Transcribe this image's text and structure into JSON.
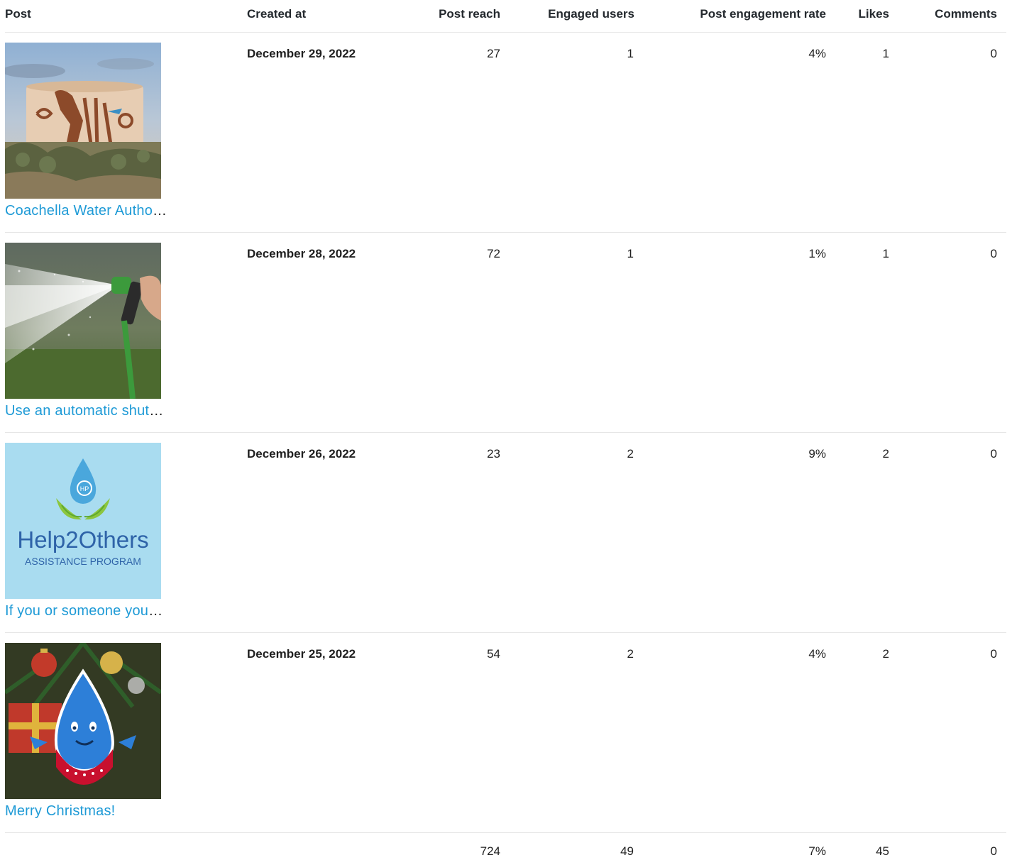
{
  "columns": {
    "post": "Post",
    "created_at": "Created at",
    "post_reach": "Post reach",
    "engaged_users": "Engaged users",
    "engagement_rate": "Post engagement rate",
    "likes": "Likes",
    "comments": "Comments"
  },
  "rows": [
    {
      "post_text": "Coachella Water Autho",
      "post_ellipsis": "…",
      "image": "water-tank-mural-image",
      "created_at": "December 29, 2022",
      "post_reach": "27",
      "engaged_users": "1",
      "engagement_rate": "4%",
      "likes": "1",
      "comments": "0"
    },
    {
      "post_text": "Use an automatic shut",
      "post_ellipsis": "…",
      "image": "garden-hose-spray-image",
      "created_at": "December 28, 2022",
      "post_reach": "72",
      "engaged_users": "1",
      "engagement_rate": "1%",
      "likes": "1",
      "comments": "0"
    },
    {
      "post_text": "If you or someone you",
      "post_ellipsis": "…",
      "image": "help2others-logo-image",
      "image_text_main": "Help2Others",
      "image_text_sub": "ASSISTANCE PROGRAM",
      "image_badge": "HP",
      "created_at": "December 26, 2022",
      "post_reach": "23",
      "engaged_users": "2",
      "engagement_rate": "9%",
      "likes": "2",
      "comments": "0"
    },
    {
      "post_text": "Merry Christmas!",
      "post_ellipsis": "",
      "image": "christmas-water-drop-image",
      "created_at": "December 25, 2022",
      "post_reach": "54",
      "engaged_users": "2",
      "engagement_rate": "4%",
      "likes": "2",
      "comments": "0"
    }
  ],
  "totals": {
    "post_reach": "724",
    "engaged_users": "49",
    "engagement_rate": "7%",
    "likes": "45",
    "comments": "0"
  },
  "colors": {
    "link": "#1e9ad6",
    "divider": "#e6e6e6",
    "header_text": "#24292e"
  }
}
